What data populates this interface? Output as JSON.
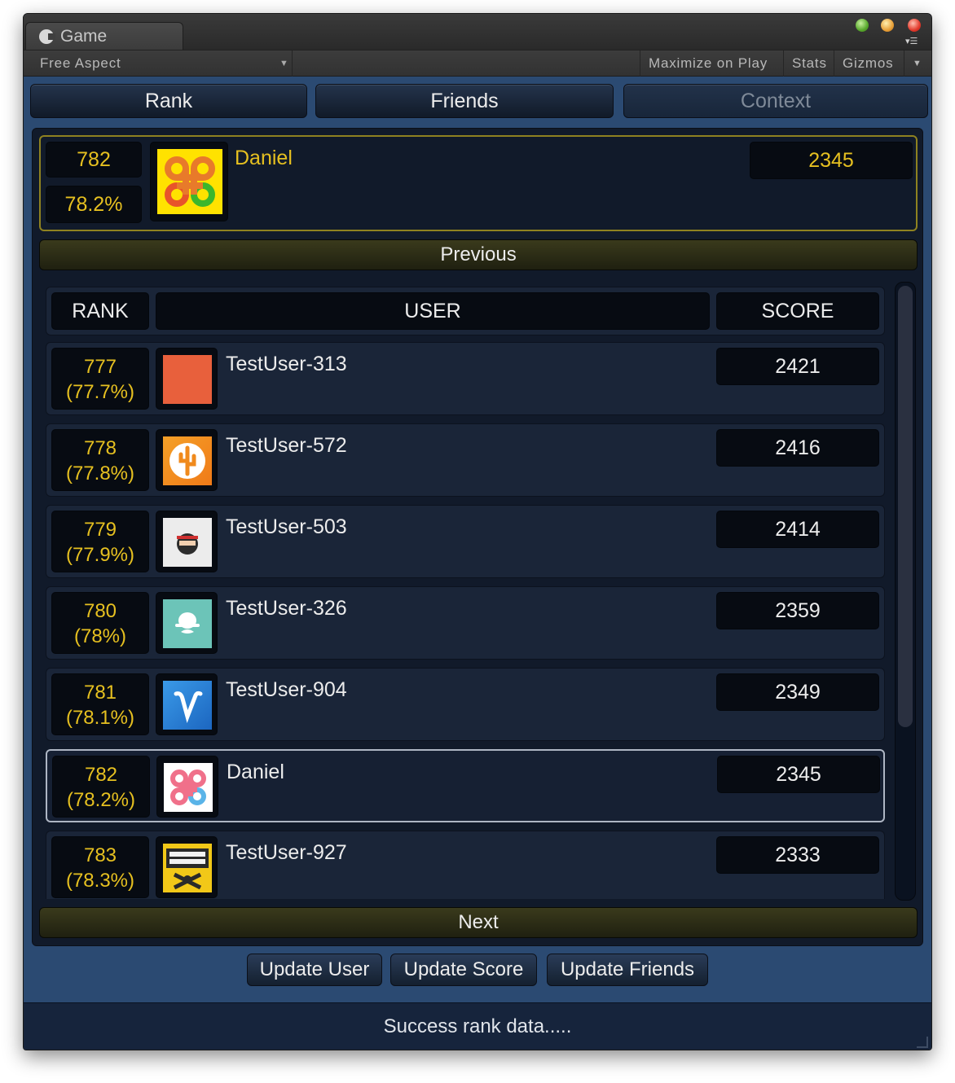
{
  "window": {
    "tab_title": "Game",
    "aspect": "Free Aspect",
    "toolbar": [
      "Maximize on Play",
      "Stats",
      "Gizmos"
    ]
  },
  "tabs": [
    {
      "label": "Rank",
      "active": true
    },
    {
      "label": "Friends",
      "active": true
    },
    {
      "label": "Context",
      "active": false
    }
  ],
  "current_user": {
    "rank": "782",
    "percent": "78.2%",
    "name": "Daniel",
    "score": "2345",
    "avatar": "command-symbol-icon"
  },
  "nav": {
    "previous": "Previous",
    "next": "Next"
  },
  "table": {
    "headers": {
      "rank": "RANK",
      "user": "USER",
      "score": "SCORE"
    },
    "rows": [
      {
        "rank": "777",
        "pct": "(77.7%)",
        "name": "TestUser-313",
        "score": "2421",
        "avatar": "orange-square-icon",
        "highlight": false
      },
      {
        "rank": "778",
        "pct": "(77.8%)",
        "name": "TestUser-572",
        "score": "2416",
        "avatar": "cactus-badge-icon",
        "highlight": false
      },
      {
        "rank": "779",
        "pct": "(77.9%)",
        "name": "TestUser-503",
        "score": "2414",
        "avatar": "ninja-icon",
        "highlight": false
      },
      {
        "rank": "780",
        "pct": "(78%)",
        "name": "TestUser-326",
        "score": "2359",
        "avatar": "mustache-hat-icon",
        "highlight": false
      },
      {
        "rank": "781",
        "pct": "(78.1%)",
        "name": "TestUser-904",
        "score": "2349",
        "avatar": "letter-v-icon",
        "highlight": false
      },
      {
        "rank": "782",
        "pct": "(78.2%)",
        "name": "Daniel",
        "score": "2345",
        "avatar": "command-symbol-icon",
        "highlight": true
      },
      {
        "rank": "783",
        "pct": "(78.3%)",
        "name": "TestUser-927",
        "score": "2333",
        "avatar": "pirate-flag-icon",
        "highlight": false
      }
    ]
  },
  "actions": [
    "Update User",
    "Update Score",
    "Update Friends"
  ],
  "status": "Success rank data.....",
  "colors": {
    "background": "#2b4a72",
    "panel": "#111a2a",
    "rank_text": "#e6c020",
    "highlight_border": "#8f8220"
  }
}
